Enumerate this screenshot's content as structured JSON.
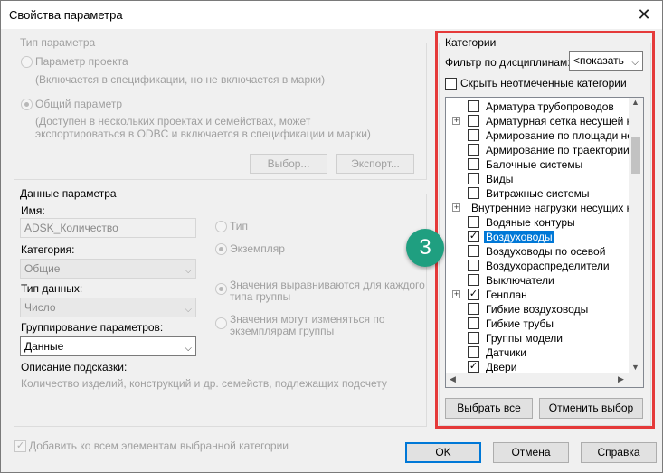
{
  "window": {
    "title": "Свойства параметра",
    "close_glyph": "✕"
  },
  "param_type": {
    "group_label": "Тип параметра",
    "project_param": "Параметр проекта",
    "project_desc": "(Включается в спецификации, но не включается в марки)",
    "shared_param": "Общий параметр",
    "shared_desc_1": "(Доступен в нескольких проектах и семействах, может",
    "shared_desc_2": "экспортироваться в ODBC и включается в спецификации и марки)",
    "select_button": "Выбор...",
    "export_button": "Экспорт..."
  },
  "param_data": {
    "group_label": "Данные параметра",
    "name_label": "Имя:",
    "name_value": "ADSK_Количество",
    "type_radio": "Тип",
    "instance_radio": "Экземпляр",
    "category_label": "Категория:",
    "category_value": "Общие",
    "datatype_label": "Тип данных:",
    "datatype_value": "Число",
    "align_radio_1": "Значения выравниваются для каждого",
    "align_radio_2": "типа группы",
    "vary_radio_1": "Значения могут изменяться по",
    "vary_radio_2": "экземплярам группы",
    "grouping_label": "Группирование параметров:",
    "grouping_value": "Данные",
    "tooltip_label": "Описание подсказки:",
    "tooltip_value": "Количество изделий, конструкций и др. семейств, подлежащих подсчету"
  },
  "categories": {
    "group_label": "Категории",
    "filter_label": "Фильтр по дисциплинам:",
    "filter_value": "<показать",
    "hide_unchecked": "Скрыть неотмеченные категории",
    "items": [
      {
        "label": "Арматура трубопроводов",
        "checked": false,
        "expand": false,
        "has_cb": true
      },
      {
        "label": "Арматурная сетка несущей конс",
        "checked": false,
        "expand": true,
        "has_cb": true
      },
      {
        "label": "Армирование по площади несу",
        "checked": false,
        "expand": false,
        "has_cb": true
      },
      {
        "label": "Армирование по траектории не",
        "checked": false,
        "expand": false,
        "has_cb": true
      },
      {
        "label": "Балочные системы",
        "checked": false,
        "expand": false,
        "has_cb": true
      },
      {
        "label": "Виды",
        "checked": false,
        "expand": false,
        "has_cb": true
      },
      {
        "label": "Витражные системы",
        "checked": false,
        "expand": false,
        "has_cb": true
      },
      {
        "label": "Внутренние нагрузки несущих кон",
        "checked": false,
        "expand": true,
        "has_cb": false
      },
      {
        "label": "Водяные контуры",
        "checked": false,
        "expand": false,
        "has_cb": true
      },
      {
        "label": "Воздуховоды",
        "checked": true,
        "expand": false,
        "has_cb": true,
        "selected": true
      },
      {
        "label": "Воздуховоды по осевой",
        "checked": false,
        "expand": false,
        "has_cb": true
      },
      {
        "label": "Воздухораспределители",
        "checked": false,
        "expand": false,
        "has_cb": true
      },
      {
        "label": "Выключатели",
        "checked": false,
        "expand": false,
        "has_cb": true
      },
      {
        "label": "Генплан",
        "checked": true,
        "expand": true,
        "has_cb": true
      },
      {
        "label": "Гибкие воздуховоды",
        "checked": false,
        "expand": false,
        "has_cb": true
      },
      {
        "label": "Гибкие трубы",
        "checked": false,
        "expand": false,
        "has_cb": true
      },
      {
        "label": "Группы модели",
        "checked": false,
        "expand": false,
        "has_cb": true
      },
      {
        "label": "Датчики",
        "checked": false,
        "expand": false,
        "has_cb": true
      },
      {
        "label": "Двери",
        "checked": true,
        "expand": false,
        "has_cb": true
      }
    ],
    "select_all": "Выбрать все",
    "deselect": "Отменить выбор"
  },
  "footer": {
    "add_all": "Добавить ко всем элементам выбранной категории",
    "ok": "OK",
    "cancel": "Отмена",
    "help": "Справка"
  },
  "callout": {
    "number": "3",
    "color": "#1f9f80"
  },
  "highlight_color": "#e53a3a"
}
